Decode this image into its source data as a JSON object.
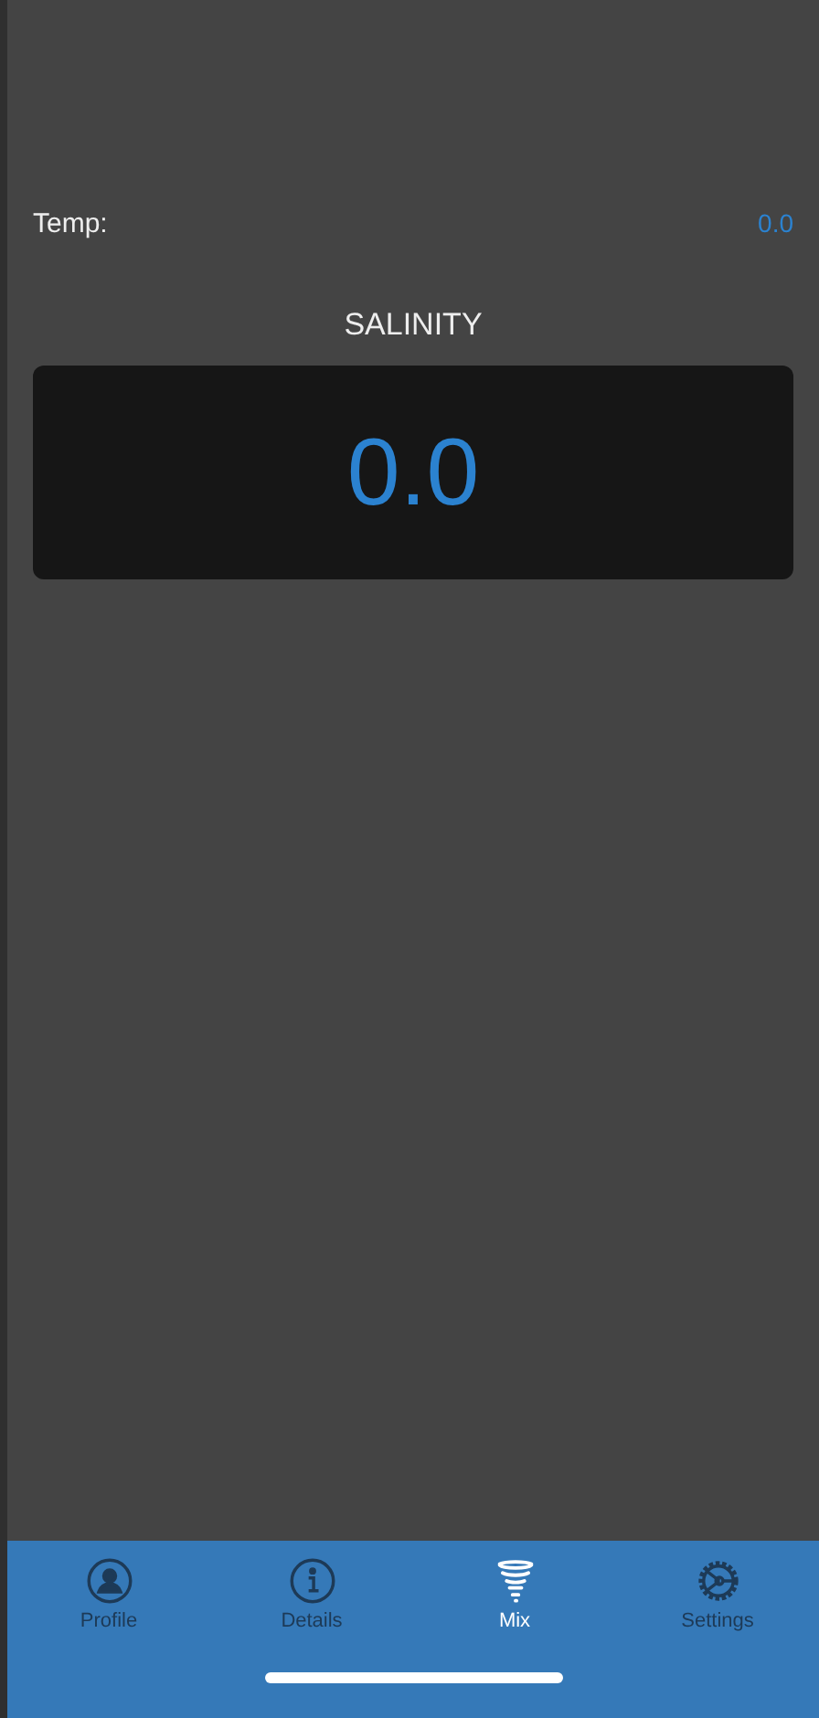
{
  "temperature": {
    "label": "Temp:",
    "value": "0.0"
  },
  "salinity": {
    "title": "SALINITY",
    "value": "0.0"
  },
  "tabs": [
    {
      "kind": "profile",
      "label": "Profile",
      "selected": false
    },
    {
      "kind": "details",
      "label": "Details",
      "selected": false
    },
    {
      "kind": "mix",
      "label": "Mix",
      "selected": true
    },
    {
      "kind": "settings",
      "label": "Settings",
      "selected": false
    }
  ]
}
